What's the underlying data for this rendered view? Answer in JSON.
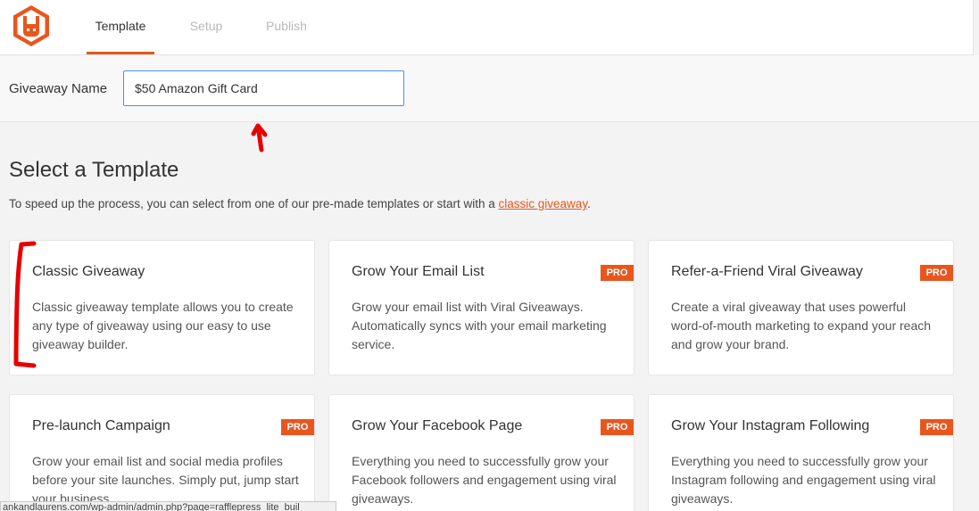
{
  "colors": {
    "accent": "#e8561d",
    "input_focus": "#4a90e2",
    "annotation": "#e60000"
  },
  "logo": {
    "icon": "rabbit-logo-icon"
  },
  "tabs": [
    {
      "label": "Template",
      "active": true
    },
    {
      "label": "Setup",
      "active": false
    },
    {
      "label": "Publish",
      "active": false
    }
  ],
  "giveaway_name": {
    "label": "Giveaway Name",
    "value": "$50 Amazon Gift Card"
  },
  "section": {
    "title": "Select a Template",
    "desc_prefix": "To speed up the process, you can select from one of our pre-made templates or start with a ",
    "desc_link": "classic giveaway",
    "desc_suffix": "."
  },
  "cards": [
    {
      "title": "Classic Giveaway",
      "desc": "Classic giveaway template allows you to create any type of giveaway using our easy to use giveaway builder.",
      "pro": ""
    },
    {
      "title": "Grow Your Email List",
      "desc": "Grow your email list with Viral Giveaways. Automatically syncs with your email marketing service.",
      "pro": "PRO"
    },
    {
      "title": "Refer-a-Friend Viral Giveaway",
      "desc": "Create a viral giveaway that uses powerful word-of-mouth marketing to expand your reach and grow your brand.",
      "pro": "PRO"
    },
    {
      "title": "Pre-launch Campaign",
      "desc": "Grow your email list and social media profiles before your site launches. Simply put, jump start your business.",
      "pro": "PRO"
    },
    {
      "title": "Grow Your Facebook Page",
      "desc": "Everything you need to successfully grow your Facebook followers and engagement using viral giveaways.",
      "pro": "PRO"
    },
    {
      "title": "Grow Your Instagram Following",
      "desc": "Everything you need to successfully grow your Instagram following and engagement using viral giveaways.",
      "pro": "PRO"
    }
  ],
  "status_url": "ankandlaurens.com/wp-admin/admin.php?page=rafflepress_lite_buil"
}
